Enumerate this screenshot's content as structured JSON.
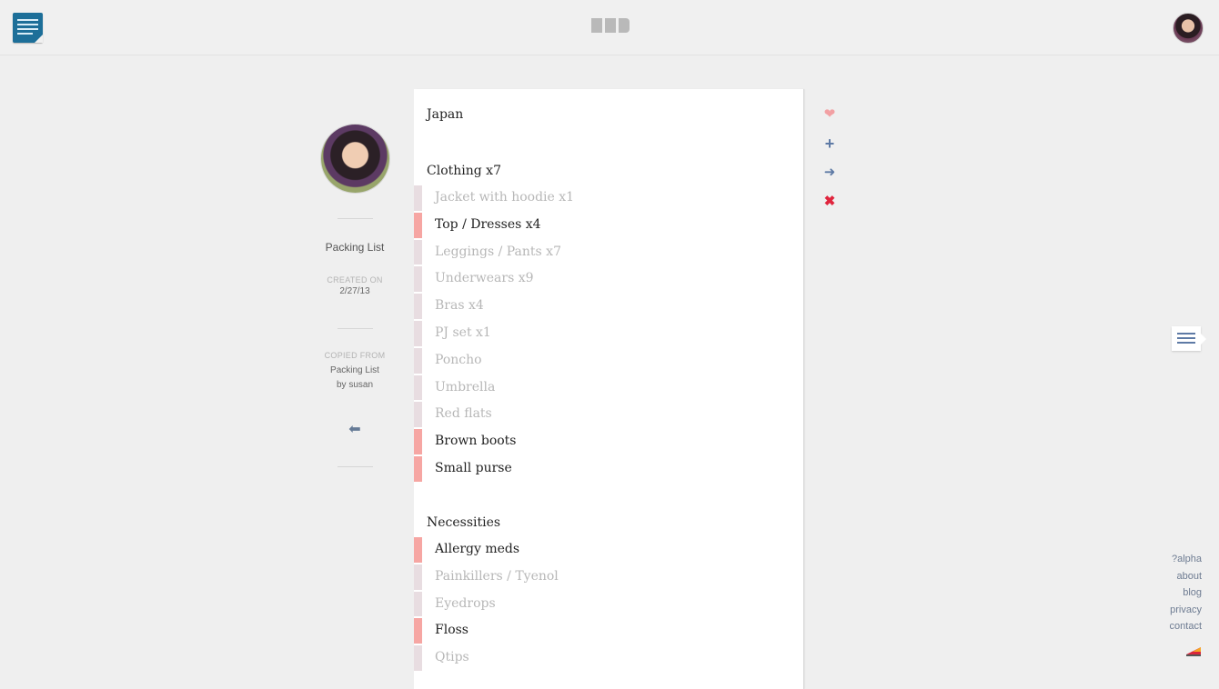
{
  "header": {
    "menu_icon": "notes-menu-icon",
    "logo_icon": "app-logo-blocks",
    "avatar_icon": "user-avatar"
  },
  "profile": {
    "list_name": "Packing List",
    "created_label": "CREATED ON",
    "created_date": "2/27/13",
    "copied_label": "COPIED FROM",
    "copied_list": "Packing List",
    "copied_by": "by susan"
  },
  "list": {
    "title": "Japan",
    "sections": [
      {
        "heading": "Clothing x7",
        "items": [
          {
            "label": "Jacket with hoodie x1",
            "checked": true
          },
          {
            "label": "Top / Dresses x4",
            "checked": false
          },
          {
            "label": "Leggings / Pants x7",
            "checked": true
          },
          {
            "label": "Underwears x9",
            "checked": true
          },
          {
            "label": "Bras x4",
            "checked": true
          },
          {
            "label": "PJ set x1",
            "checked": true
          },
          {
            "label": "Poncho",
            "checked": true
          },
          {
            "label": "Umbrella",
            "checked": true
          },
          {
            "label": "Red flats",
            "checked": true
          },
          {
            "label": "Brown boots",
            "checked": false
          },
          {
            "label": "Small purse",
            "checked": false
          }
        ]
      },
      {
        "heading": "Necessities",
        "items": [
          {
            "label": "Allergy meds",
            "checked": false
          },
          {
            "label": "Painkillers / Tyenol",
            "checked": true
          },
          {
            "label": "Eyedrops",
            "checked": true
          },
          {
            "label": "Floss",
            "checked": false
          },
          {
            "label": "Qtips",
            "checked": true
          }
        ]
      }
    ]
  },
  "actions": {
    "like_icon": "heart-icon",
    "add_icon": "plus-icon",
    "share_icon": "arrow-right-icon",
    "delete_icon": "close-icon"
  },
  "footer": {
    "links": [
      "?alpha",
      "about",
      "blog",
      "privacy",
      "contact"
    ]
  },
  "colors": {
    "unchecked_bar": "#f6a6a3",
    "checked_bar": "#e8dde1",
    "accent_blue": "#5e7aa5",
    "delete_red": "#e0253d",
    "app_icon_blue": "#1d6f99"
  }
}
